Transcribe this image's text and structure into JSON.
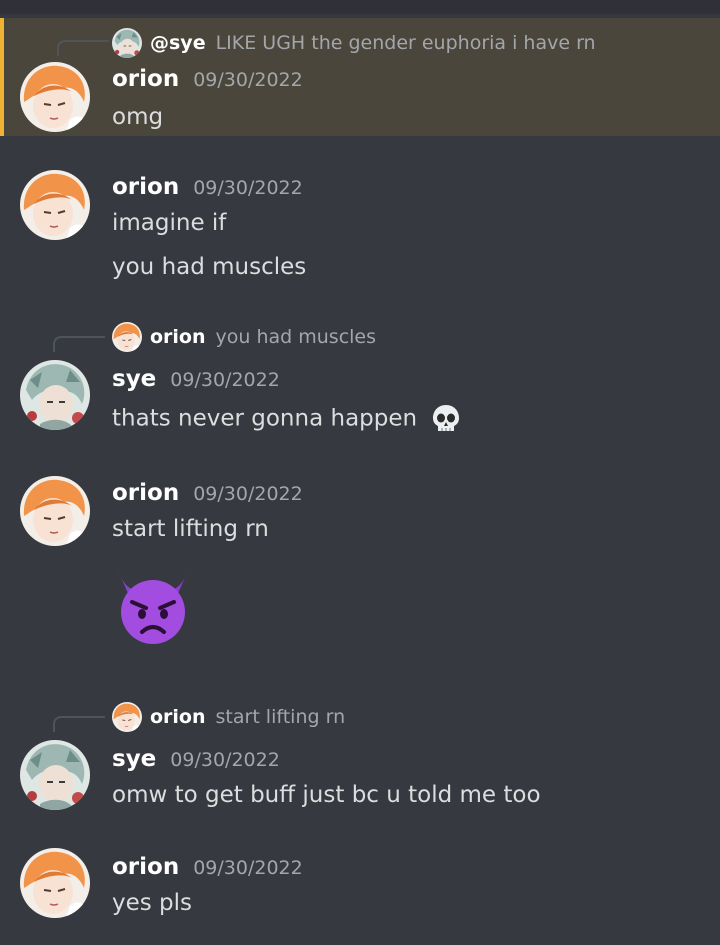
{
  "messages": [
    {
      "author": "orion",
      "timestamp": "09/30/2022",
      "reply": {
        "author": "@sye",
        "text": "LIKE UGH the gender euphoria i have rn"
      },
      "lines": [
        "omg"
      ]
    },
    {
      "author": "orion",
      "timestamp": "09/30/2022",
      "lines": [
        "imagine if",
        "you had muscles"
      ]
    },
    {
      "author": "sye",
      "timestamp": "09/30/2022",
      "reply": {
        "author": "orion",
        "text": "you had muscles"
      },
      "lines": [
        "thats never gonna happen"
      ],
      "emoji": "skull-icon"
    },
    {
      "author": "orion",
      "timestamp": "09/30/2022",
      "lines": [
        "start lifting rn"
      ],
      "emoji": "angry-devil-emoji"
    },
    {
      "author": "sye",
      "timestamp": "09/30/2022",
      "reply": {
        "author": "orion",
        "text": "start lifting rn"
      },
      "lines": [
        "omw to get buff just bc u told me too"
      ]
    },
    {
      "author": "orion",
      "timestamp": "09/30/2022",
      "lines": [
        "yes pls"
      ]
    }
  ],
  "colors": {
    "background": "#36393f",
    "highlight": "#4a463c",
    "highlight_border": "#f0b232",
    "author": "#ffffff",
    "timestamp": "#a3a6aa",
    "text": "#dcddde"
  }
}
